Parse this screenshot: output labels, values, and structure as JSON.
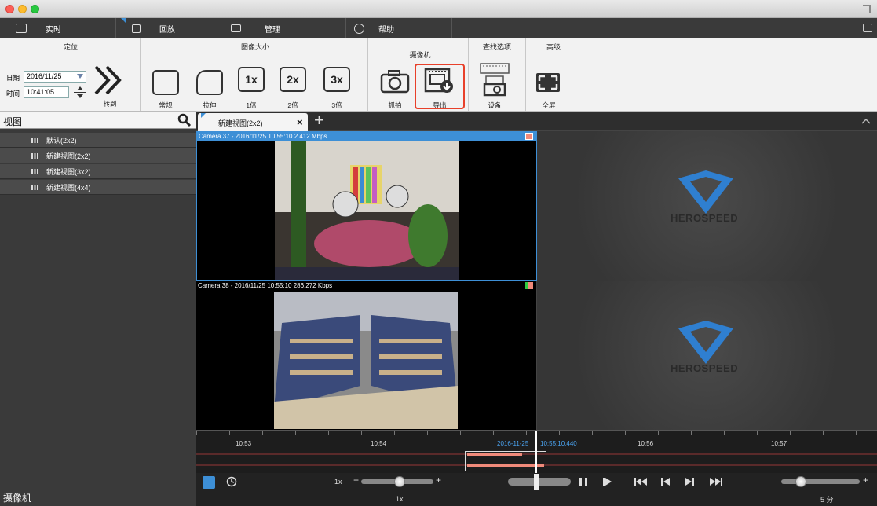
{
  "tabs": {
    "live": "实时",
    "playback": "回放",
    "manage": "管理",
    "help": "帮助"
  },
  "ribbon": {
    "locate_title": "定位",
    "date_label": "日期",
    "date_value": "2016/11/25",
    "time_label": "时间",
    "time_value": "10:41:05",
    "goto_label": "转到",
    "image_size_title": "图像大小",
    "normal_label": "常规",
    "stretch_label": "拉伸",
    "zoom1_label": "1倍",
    "zoom2_label": "2倍",
    "zoom3_label": "3倍",
    "zoom1_icon": "1x",
    "zoom2_icon": "2x",
    "zoom3_icon": "3x",
    "camera_title": "摄像机",
    "snapshot_label": "抓拍",
    "export_label": "导出",
    "search_title": "查找选项",
    "device_label": "设备",
    "advanced_title": "高级",
    "fullscreen_label": "全屏"
  },
  "sidebar": {
    "header": "视图",
    "items": [
      {
        "label": "默认(2x2)"
      },
      {
        "label": "新建视图(2x2)"
      },
      {
        "label": "新建视图(3x2)"
      },
      {
        "label": "新建视图(4x4)"
      }
    ],
    "footer": "摄像机"
  },
  "viewtab": {
    "label": "新建视图(2x2)",
    "close": "×",
    "add": "+"
  },
  "cameras": [
    {
      "label": "Camera 37  - 2016/11/25 10:55:10  2.412 Mbps"
    },
    {
      "label": "Camera 38  - 2016/11/25 10:55:10  286.272 Kbps"
    }
  ],
  "logo_text": "HEROSPEED",
  "timeline": {
    "ticks": [
      "10:53",
      "10:54",
      "10:56",
      "10:57"
    ],
    "current_date": "2016-11-25",
    "current_time": "10:55:10.440"
  },
  "controls": {
    "speed_top": "1x",
    "speed_bottom": "1x",
    "range_label": "5 分"
  },
  "colors": {
    "export_highlight": "#e8402a",
    "selection_blue": "#3d8fd6",
    "logo_blue": "#2f7fd0"
  }
}
